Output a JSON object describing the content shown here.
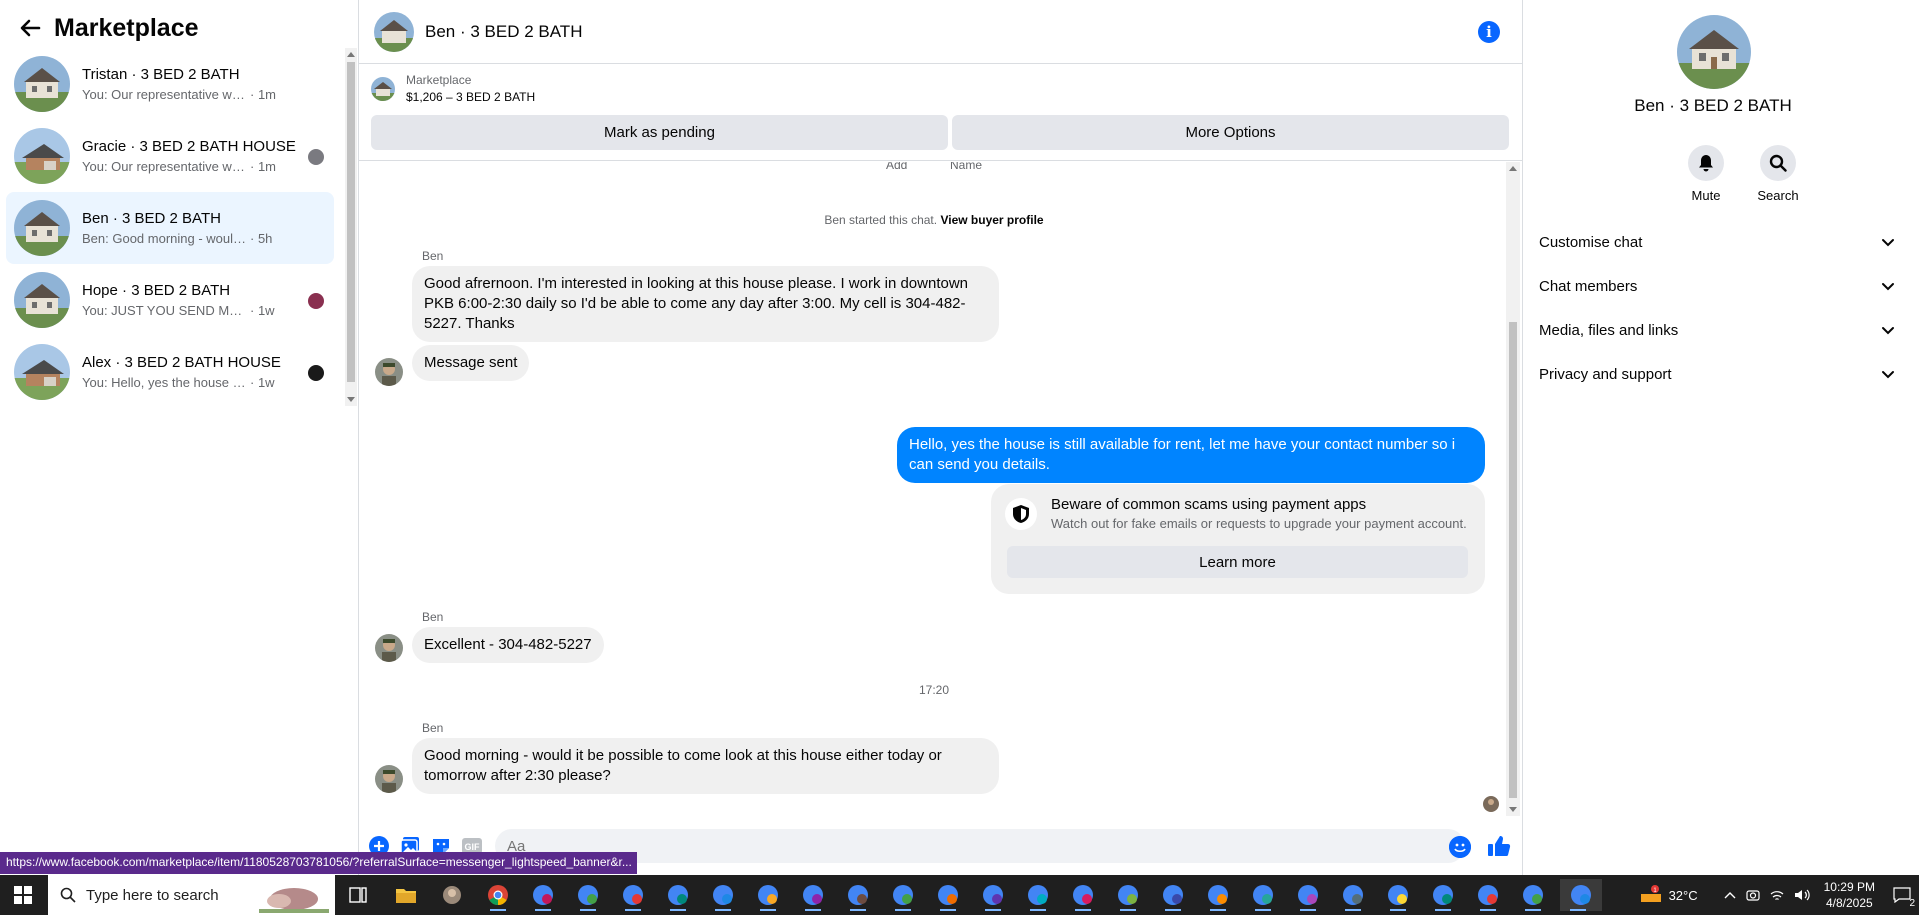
{
  "left": {
    "title": "Marketplace",
    "conversations": [
      {
        "name": "Tristan · 3 BED 2 BATH",
        "preview": "You: Our representative will conta...",
        "time": "· 1m"
      },
      {
        "name": "Gracie · 3 BED 2 BATH HOUSE",
        "preview": "You: Our representative will con...",
        "time": "· 1m"
      },
      {
        "name": "Ben · 3 BED 2 BATH",
        "preview": "Ben: Good morning - would it be p...",
        "time": "· 5h"
      },
      {
        "name": "Hope · 3 BED 2 BATH",
        "preview": "You: JUST YOU SEND ME NUM...",
        "time": "· 1w"
      },
      {
        "name": "Alex · 3 BED 2 BATH HOUSE",
        "preview": "You: Hello, yes the house is still ...",
        "time": "· 1w"
      }
    ]
  },
  "chat": {
    "title": "Ben · 3 BED 2 BATH",
    "marketplace_label": "Marketplace",
    "listing": "$1,206 – 3 BED 2 BATH",
    "mark_pending": "Mark as pending",
    "more_options": "More Options",
    "cut_left": "Add",
    "cut_right": "Name",
    "started": "Ben started this chat.",
    "view_profile": "View buyer profile",
    "sender": "Ben",
    "msg1": "Good afrernoon. I'm interested in looking at this house please.  I work in downtown PKB 6:00-2:30 daily so I'd be able to come any day after 3:00.  My cell is 304-482-5227. Thanks",
    "msg2": "Message sent",
    "msg3": "Hello, yes the house is still available for rent, let me have your contact number so i can send you details.",
    "scam_title": "Beware of common scams using payment apps",
    "scam_sub": "Watch out for fake emails or requests to upgrade your payment account.",
    "learn_more": "Learn more",
    "msg4": "Excellent - 304-482-5227",
    "time": "17:20",
    "msg5": "Good morning - would it be possible to come look at this house either today or tomorrow after 2:30 please?",
    "composer_placeholder": "Aa"
  },
  "right": {
    "name": "Ben · 3 BED 2 BATH",
    "mute": "Mute",
    "search": "Search",
    "sections": [
      "Customise chat",
      "Chat members",
      "Media, files and links",
      "Privacy and support"
    ]
  },
  "status_url": "https://www.facebook.com/marketplace/item/1180528703781056/?referralSurface=messenger_lightspeed_banner&r...",
  "taskbar": {
    "search_placeholder": "Type here to search",
    "temp": "32°C",
    "time": "10:29 PM",
    "date": "4/8/2025",
    "notifications": "2"
  }
}
